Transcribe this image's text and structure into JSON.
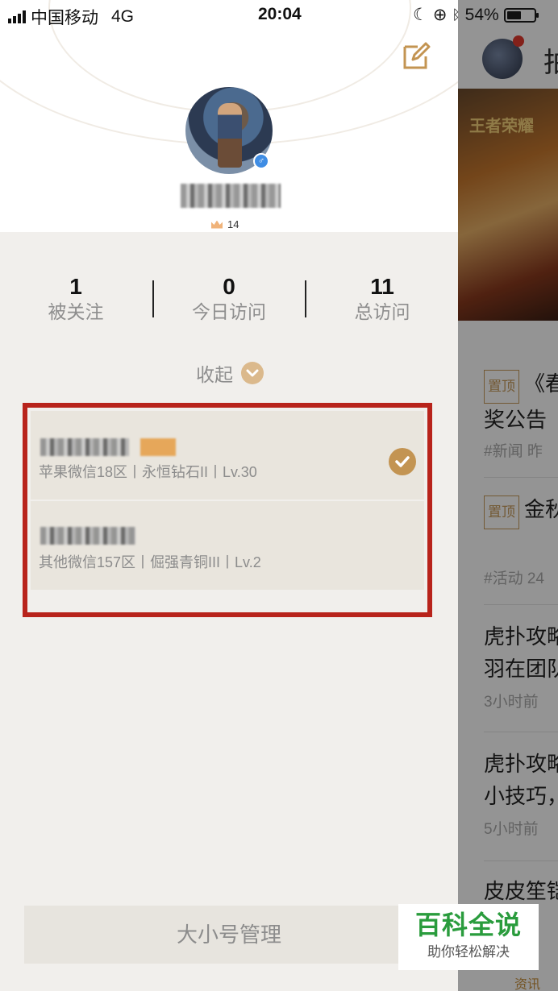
{
  "status_bar": {
    "carrier": "中国移动",
    "network": "4G",
    "time": "20:04",
    "battery": "54%"
  },
  "profile": {
    "level": "14"
  },
  "stats": [
    {
      "value": "1",
      "label": "被关注"
    },
    {
      "value": "0",
      "label": "今日访问"
    },
    {
      "value": "11",
      "label": "总访问"
    }
  ],
  "collapse_label": "收起",
  "accounts": [
    {
      "info": "苹果微信18区丨永恒钻石II丨Lv.30",
      "selected": true
    },
    {
      "info": "其他微信157区丨倔强青铜III丨Lv.2",
      "selected": false
    }
  ],
  "manage_button": "大小号管理",
  "background_page": {
    "banner_logo": "王者荣耀",
    "header_fragment": "拍",
    "items": [
      {
        "tag": "置顶",
        "title": "《春",
        "title2": "奖公告",
        "meta": "#新闻  昨"
      },
      {
        "tag": "置顶",
        "title": "金秋",
        "meta": "#活动  24"
      },
      {
        "title": "虎扑攻略",
        "title2": "羽在团队",
        "meta": "3小时前"
      },
      {
        "title": "虎扑攻略",
        "title2": "小技巧，",
        "meta": "5小时前"
      },
      {
        "title": "皮皮笙铠"
      }
    ],
    "tab_label": "资讯"
  },
  "watermark": {
    "title": "百科全说",
    "subtitle": "助你轻松解决"
  },
  "colors": {
    "accent_gold": "#c39452",
    "highlight_red": "#b8231b",
    "watermark_green": "#2a9c3d"
  }
}
